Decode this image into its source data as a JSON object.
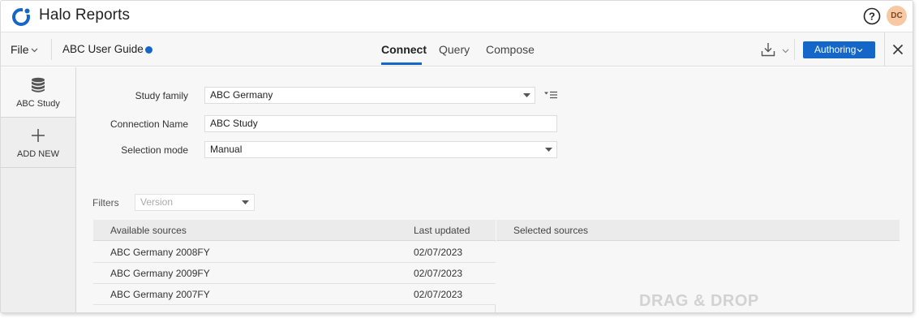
{
  "app": {
    "title": "Halo Reports",
    "user_initials": "DC"
  },
  "toolbar": {
    "file_label": "File",
    "document_name": "ABC User Guide",
    "tabs": [
      {
        "label": "Connect",
        "active": true
      },
      {
        "label": "Query",
        "active": false
      },
      {
        "label": "Compose",
        "active": false
      }
    ],
    "authoring_label": "Authoring"
  },
  "sidebar": {
    "items": [
      {
        "label": "ABC Study",
        "icon": "database-icon",
        "active": true
      },
      {
        "label": "ADD NEW",
        "icon": "plus-icon",
        "active": false
      }
    ]
  },
  "form": {
    "study_family_label": "Study family",
    "study_family_value": "ABC Germany",
    "connection_name_label": "Connection Name",
    "connection_name_value": "ABC Study",
    "selection_mode_label": "Selection mode",
    "selection_mode_value": "Manual"
  },
  "filters": {
    "label": "Filters",
    "version_placeholder": "Version"
  },
  "sources": {
    "columns": {
      "available": "Available sources",
      "last_updated": "Last updated",
      "selected": "Selected sources"
    },
    "rows": [
      {
        "name": "ABC Germany 2008FY",
        "updated": "02/07/2023"
      },
      {
        "name": "ABC Germany 2009FY",
        "updated": "02/07/2023"
      },
      {
        "name": "ABC Germany 2007FY",
        "updated": "02/07/2023"
      }
    ],
    "drop_hint": "DRAG & DROP"
  },
  "colors": {
    "accent": "#1466c8",
    "avatar_bg": "#f6c9a3"
  }
}
